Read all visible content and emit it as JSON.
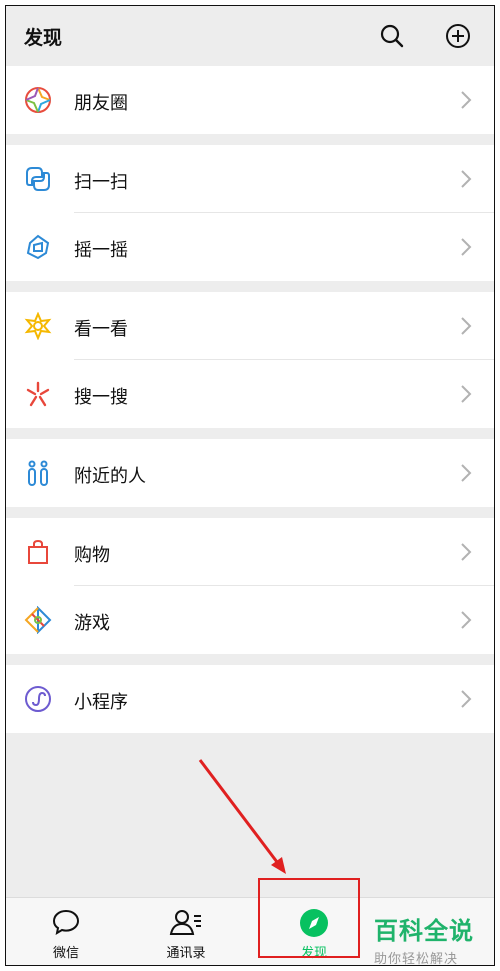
{
  "header": {
    "title": "发现",
    "search_icon": "search-icon",
    "add_icon": "plus-circle-icon"
  },
  "sections": [
    {
      "items": [
        {
          "label": "朋友圈",
          "icon": "moments-icon"
        }
      ]
    },
    {
      "items": [
        {
          "label": "扫一扫",
          "icon": "scan-icon"
        },
        {
          "label": "摇一摇",
          "icon": "shake-icon"
        }
      ]
    },
    {
      "items": [
        {
          "label": "看一看",
          "icon": "top-stories-icon"
        },
        {
          "label": "搜一搜",
          "icon": "search-sparkle-icon"
        }
      ]
    },
    {
      "items": [
        {
          "label": "附近的人",
          "icon": "people-nearby-icon"
        }
      ]
    },
    {
      "items": [
        {
          "label": "购物",
          "icon": "shopping-bag-icon"
        },
        {
          "label": "游戏",
          "icon": "games-icon"
        }
      ]
    },
    {
      "items": [
        {
          "label": "小程序",
          "icon": "mini-program-icon"
        }
      ]
    }
  ],
  "tabbar": {
    "tabs": [
      {
        "label": "微信",
        "icon": "chat-bubble-icon",
        "active": false
      },
      {
        "label": "通讯录",
        "icon": "contacts-icon",
        "active": false
      },
      {
        "label": "发现",
        "icon": "compass-icon",
        "active": true
      }
    ]
  },
  "colors": {
    "active": "#07c160",
    "annotation": "#e02020",
    "background": "#ededed"
  },
  "watermark": {
    "title": "百科全说",
    "subtitle": "助你轻松解决"
  }
}
